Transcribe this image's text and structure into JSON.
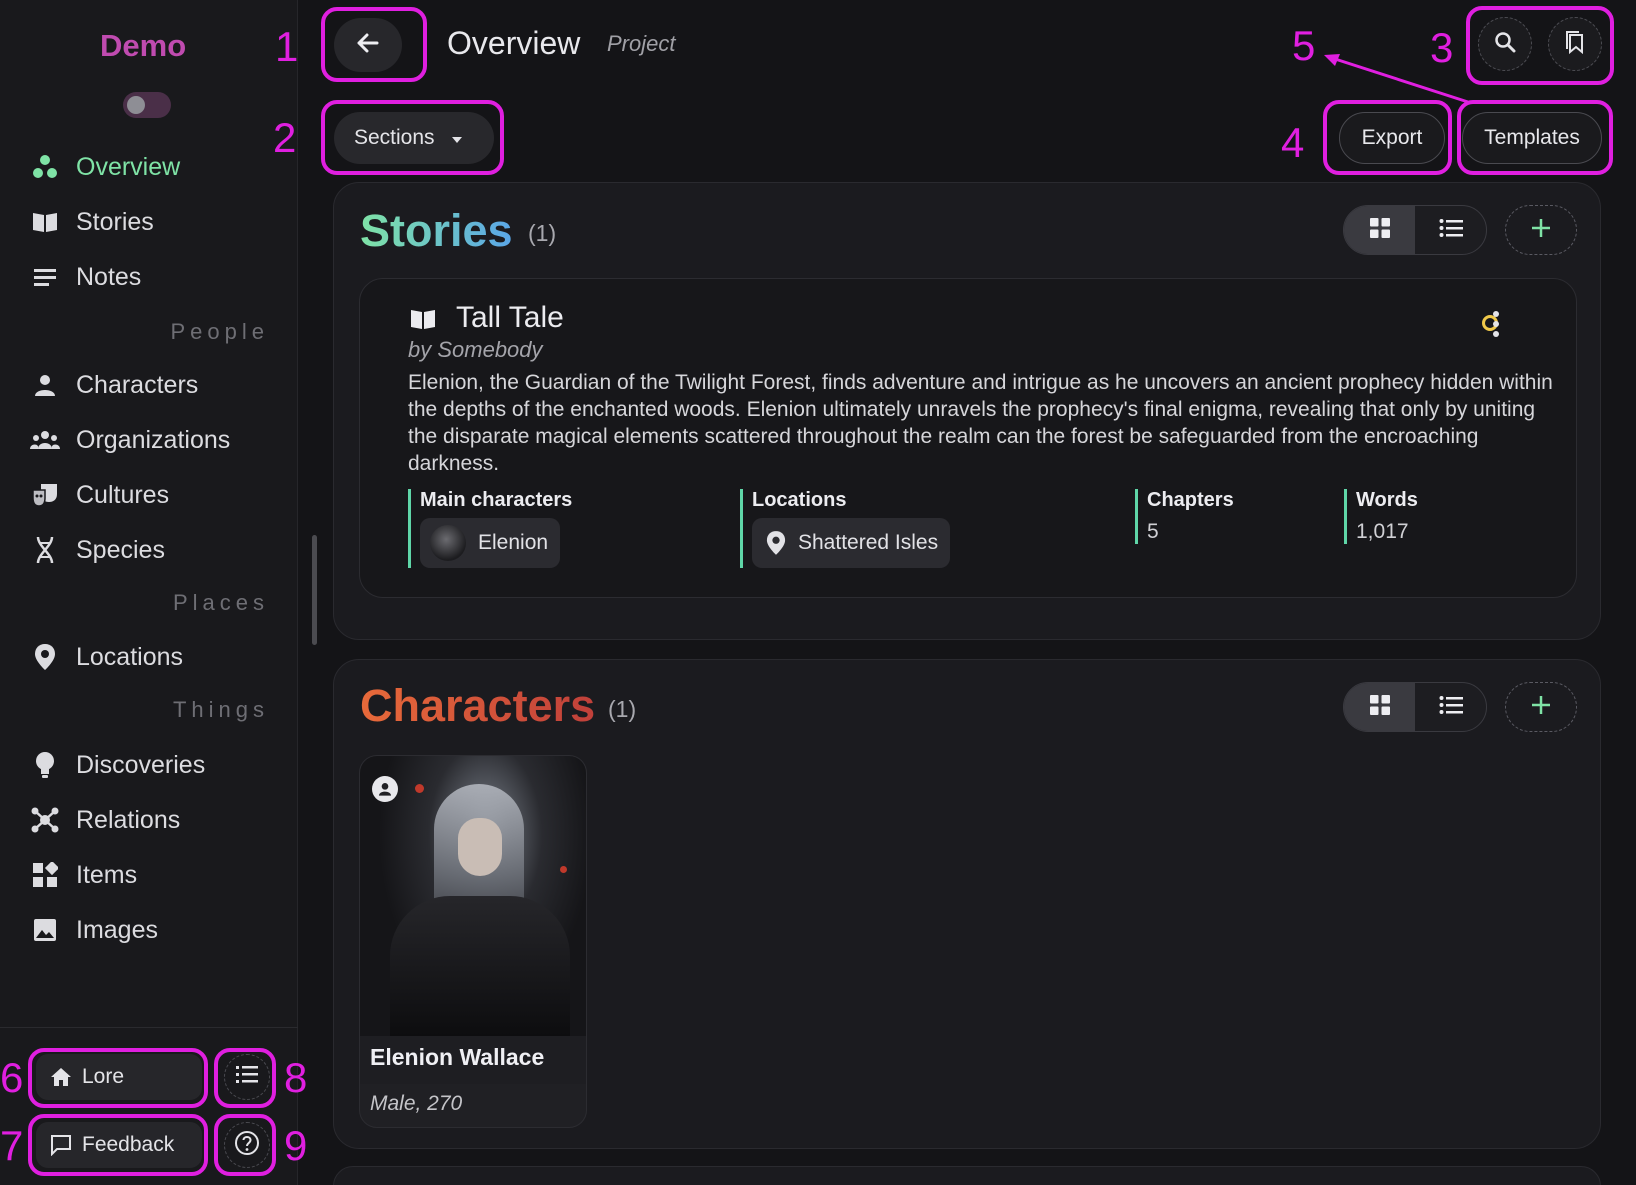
{
  "app": {
    "brand": "Demo"
  },
  "sidebar": {
    "items": [
      {
        "label": "Overview",
        "icon": "overview-icon"
      },
      {
        "label": "Stories",
        "icon": "book-icon"
      },
      {
        "label": "Notes",
        "icon": "notes-icon"
      },
      {
        "label": "Characters",
        "icon": "person-icon"
      },
      {
        "label": "Organizations",
        "icon": "group-icon"
      },
      {
        "label": "Cultures",
        "icon": "masks-icon"
      },
      {
        "label": "Species",
        "icon": "dna-icon"
      },
      {
        "label": "Locations",
        "icon": "pin-icon"
      },
      {
        "label": "Discoveries",
        "icon": "lightbulb-icon"
      },
      {
        "label": "Relations",
        "icon": "network-icon"
      },
      {
        "label": "Items",
        "icon": "items-icon"
      },
      {
        "label": "Images",
        "icon": "image-icon"
      }
    ],
    "groups": {
      "people": "People",
      "places": "Places",
      "things": "Things"
    },
    "lore_label": "Lore",
    "feedback_label": "Feedback"
  },
  "header": {
    "title": "Overview",
    "subtitle": "Project",
    "sections_label": "Sections",
    "export_label": "Export",
    "templates_label": "Templates"
  },
  "annotations": [
    "1",
    "2",
    "3",
    "4",
    "5",
    "6",
    "7",
    "8",
    "9"
  ],
  "stories": {
    "title": "Stories",
    "count": "(1)",
    "card": {
      "title": "Tall Tale",
      "author": "by Somebody",
      "description": "Elenion, the Guardian of the Twilight Forest, finds adventure and intrigue as he uncovers an ancient prophecy hidden within the depths of the enchanted woods. Elenion ultimately unravels the prophecy's final enigma, revealing that only by uniting the disparate magical elements scattered throughout the realm can the forest be safeguarded from the encroaching darkness.",
      "main_characters_label": "Main characters",
      "main_character": "Elenion",
      "locations_label": "Locations",
      "location": "Shattered Isles",
      "chapters_label": "Chapters",
      "chapters": "5",
      "words_label": "Words",
      "words": "1,017"
    }
  },
  "characters": {
    "title": "Characters",
    "count": "(1)",
    "card": {
      "name": "Elenion Wallace",
      "info": "Male, 270"
    }
  },
  "colors": {
    "brand": "#c04bb0",
    "active": "#7fe3a6",
    "annotation": "#e01fe0",
    "accent_bar": "#5fd6a8",
    "status": "#f0c94a"
  }
}
